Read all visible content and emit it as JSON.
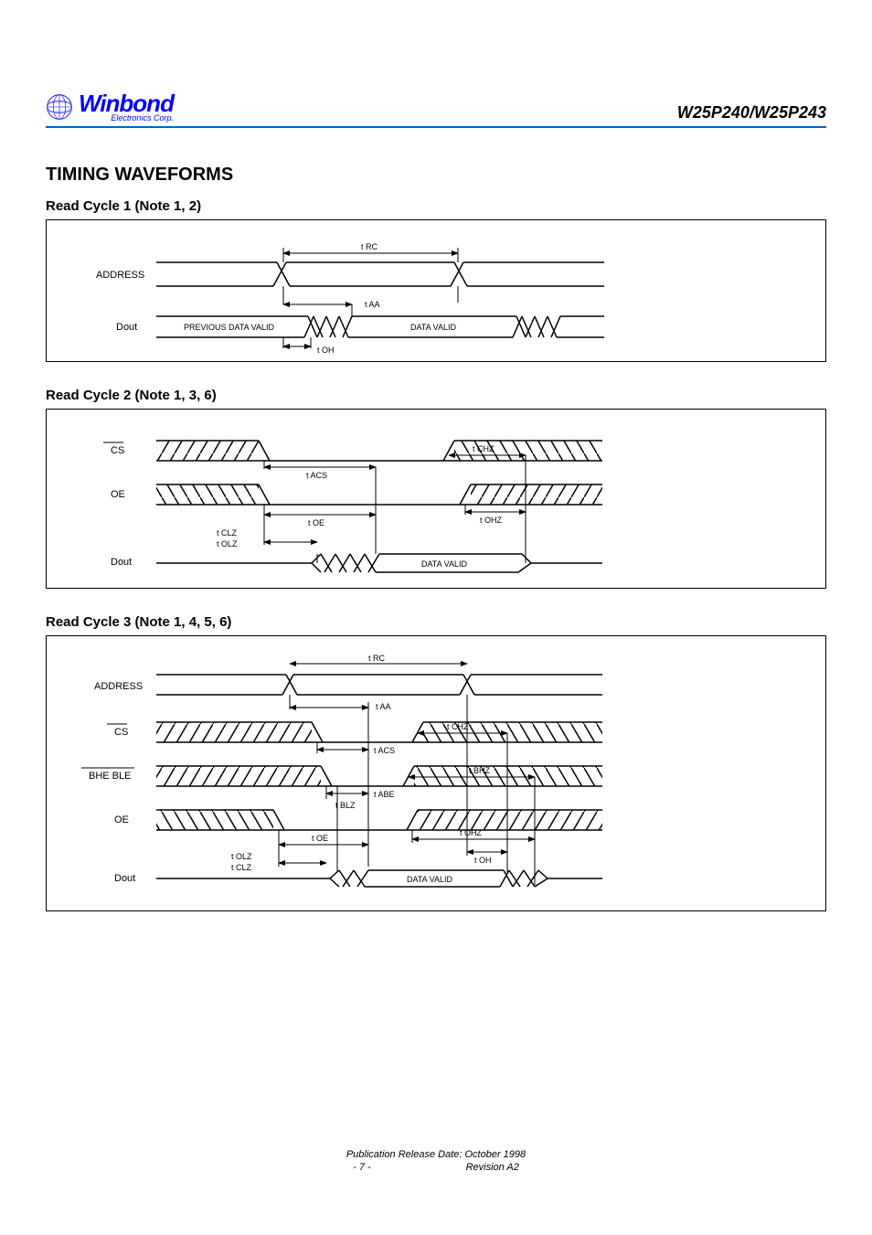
{
  "header": {
    "brand": "Winbond",
    "brand_sub": "Electronics Corp.",
    "part": "W25P240/W25P243"
  },
  "section_title": "TIMING WAVEFORMS",
  "diag1": {
    "title": "Read Cycle 1 (Note 1, 2)",
    "address": "ADDRESS",
    "dout": "Dout",
    "prev_valid": "PREVIOUS DATA VALID",
    "data_valid": "DATA VALID",
    "t_rc": "t RC",
    "t_aa": "t AA",
    "t_oh": "t OH"
  },
  "diag2": {
    "title": "Read Cycle 2 (Note 1, 3, 6)",
    "cs": "CS",
    "oe": "OE",
    "dout": "Dout",
    "data_valid": "DATA VALID",
    "t_acs": "t ACS",
    "t_oe": "t OE",
    "t_clz": "t CLZ",
    "t_olz": "t OLZ",
    "t_chz": "t CHZ",
    "t_ohz": "t OHZ"
  },
  "diag3": {
    "title": "Read Cycle 3 (Note 1, 4, 5, 6)",
    "address": "ADDRESS",
    "cs": "CS",
    "bhe_ble": "BHE BLE",
    "oe": "OE",
    "dout": "Dout",
    "data_valid": "DATA VALID",
    "t_rc": "t RC",
    "t_aa": "t AA",
    "t_acs": "t ACS",
    "t_abe": "t ABE",
    "t_blz": "t BLZ",
    "t_oe": "t OE",
    "t_olz": "t OLZ",
    "t_clz": "t CLZ",
    "t_chz": "t CHZ",
    "t_bhz": "t BHZ",
    "t_ohz": "t OHZ",
    "t_oh": "t OH"
  },
  "footer": {
    "line1": "Publication Release Date: October 1998",
    "line2": "- 7 -",
    "line3": "Revision A2"
  }
}
